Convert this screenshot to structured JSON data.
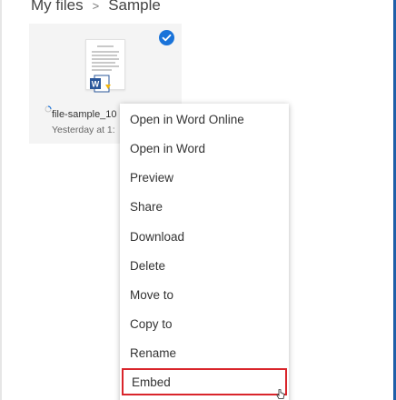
{
  "breadcrumb": {
    "root": "My files",
    "separator": ">",
    "current": "Sample"
  },
  "file_tile": {
    "name": "file-sample_10",
    "modified": "Yesterday at 1:",
    "selected": true,
    "file_type_icon": "word-icon",
    "word_icon_letter": "W"
  },
  "context_menu": {
    "items": [
      {
        "label": "Open in Word Online"
      },
      {
        "label": "Open in Word"
      },
      {
        "label": "Preview"
      },
      {
        "label": "Share"
      },
      {
        "label": "Download"
      },
      {
        "label": "Delete"
      },
      {
        "label": "Move to"
      },
      {
        "label": "Copy to"
      },
      {
        "label": "Rename"
      },
      {
        "label": "Embed",
        "highlighted": true
      }
    ]
  },
  "colors": {
    "selection_check": "#1a73d9",
    "highlight_border": "#d9252b",
    "word_blue": "#2b579a",
    "accent_rail": "#1f5fa8"
  }
}
